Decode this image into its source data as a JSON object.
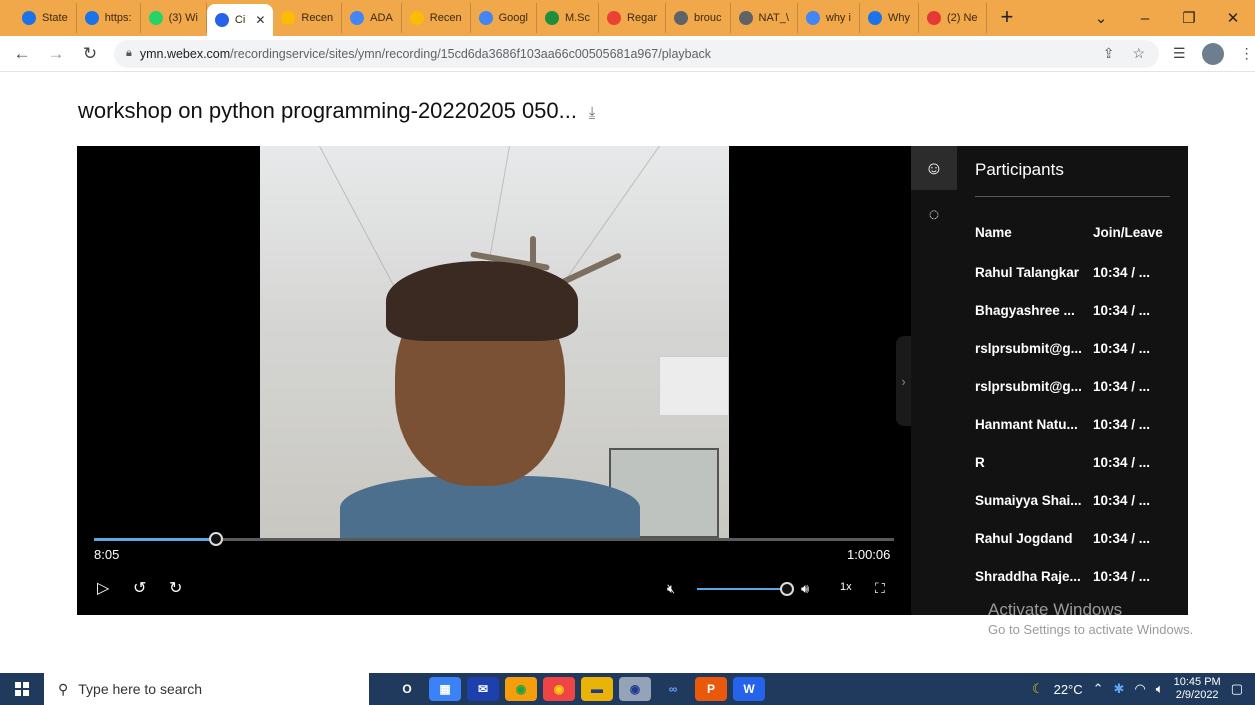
{
  "browser": {
    "tabs": [
      {
        "label": "State",
        "icon": "pin-icon",
        "color": "#1a73e8"
      },
      {
        "label": "https:",
        "icon": "pin-icon",
        "color": "#1a73e8"
      },
      {
        "label": "(3) Wi",
        "icon": "whatsapp-icon",
        "color": "#25d366"
      },
      {
        "label": "Ci",
        "icon": "webex-icon",
        "color": "#2563eb",
        "active": true
      },
      {
        "label": "Recen",
        "icon": "drive-icon",
        "color": "#fbbc04"
      },
      {
        "label": "ADA",
        "icon": "docs-icon",
        "color": "#4285f4"
      },
      {
        "label": "Recen",
        "icon": "drive-icon",
        "color": "#fbbc04"
      },
      {
        "label": "Googl",
        "icon": "google-icon",
        "color": "#4285f4"
      },
      {
        "label": "M.Sc",
        "icon": "classroom-icon",
        "color": "#1e8e3e"
      },
      {
        "label": "Regar",
        "icon": "gmail-icon",
        "color": "#ea4335"
      },
      {
        "label": "brouc",
        "icon": "globe-icon",
        "color": "#5f6368"
      },
      {
        "label": "NAT_\\",
        "icon": "globe-icon",
        "color": "#5f6368"
      },
      {
        "label": "why i",
        "icon": "google-icon",
        "color": "#4285f4"
      },
      {
        "label": "Why",
        "icon": "quora-icon",
        "color": "#1a73e8"
      },
      {
        "label": "(2) Ne",
        "icon": "youtube-icon",
        "color": "#e53935"
      }
    ],
    "new_tab": "+",
    "url_host": "ymn.webex.com",
    "url_path": "/recordingservice/sites/ymn/recording/15cd6da3686f103aa66c00505681a967/playback"
  },
  "page": {
    "title": "workshop on python programming-20220205 050...",
    "download_icon": "⤓"
  },
  "player": {
    "current_time": "8:05",
    "total_time": "1:00:06",
    "progress_fraction": 0.153,
    "volume_fraction": 1.0,
    "speed": "1x",
    "controls": {
      "play": "▷",
      "rewind": "↺",
      "forward": "↻",
      "mute": "🔇︎",
      "volume": "🔊︎",
      "fullscreen": "⛶"
    }
  },
  "participants_panel": {
    "title": "Participants",
    "columns": {
      "name": "Name",
      "join": "Join/Leave"
    },
    "rows": [
      {
        "name": "Rahul Talangkar",
        "join": "10:34 / ..."
      },
      {
        "name": "Bhagyashree ...",
        "join": "10:34 / ..."
      },
      {
        "name": "rslprsubmit@g...",
        "join": "10:34 / ..."
      },
      {
        "name": "rslprsubmit@g...",
        "join": "10:34 / ..."
      },
      {
        "name": "Hanmant Natu...",
        "join": "10:34 / ..."
      },
      {
        "name": "R",
        "join": "10:34 / ..."
      },
      {
        "name": "Sumaiyya Shai...",
        "join": "10:34 / ..."
      },
      {
        "name": "Rahul Jogdand",
        "join": "10:34 / ..."
      },
      {
        "name": "Shraddha Raje...",
        "join": "10:34 / ..."
      }
    ]
  },
  "watermark": {
    "line1": "Activate Windows",
    "line2": "Go to Settings to activate Windows."
  },
  "taskbar": {
    "search_placeholder": "Type here to search",
    "weather": "22°C",
    "time": "10:45 PM",
    "date": "2/9/2022",
    "apps": [
      {
        "name": "task-view-icon",
        "glyph": "O",
        "color": "#1f3a5c",
        "fg": "#ffffff"
      },
      {
        "name": "store-icon",
        "glyph": "▦",
        "color": "#3b82f6",
        "fg": "#ffffff"
      },
      {
        "name": "mail-icon",
        "glyph": "✉",
        "color": "#1e40af",
        "fg": "#ffffff"
      },
      {
        "name": "chrome-icon",
        "glyph": "◉",
        "color": "#f59e0b",
        "fg": "#16a34a"
      },
      {
        "name": "chrome-profile-icon",
        "glyph": "◉",
        "color": "#ef4444",
        "fg": "#facc15"
      },
      {
        "name": "file-explorer-icon",
        "glyph": "▬",
        "color": "#eab308",
        "fg": "#1e3a8a"
      },
      {
        "name": "chrome-active-icon",
        "glyph": "◉",
        "color": "#94a3b8",
        "fg": "#1e3a8a"
      },
      {
        "name": "webex-icon",
        "glyph": "∞",
        "color": "#1f3a5c",
        "fg": "#60a5fa"
      },
      {
        "name": "powerpoint-icon",
        "glyph": "P",
        "color": "#ea580c",
        "fg": "#ffffff"
      },
      {
        "name": "word-icon",
        "glyph": "W",
        "color": "#2563eb",
        "fg": "#ffffff"
      }
    ]
  }
}
